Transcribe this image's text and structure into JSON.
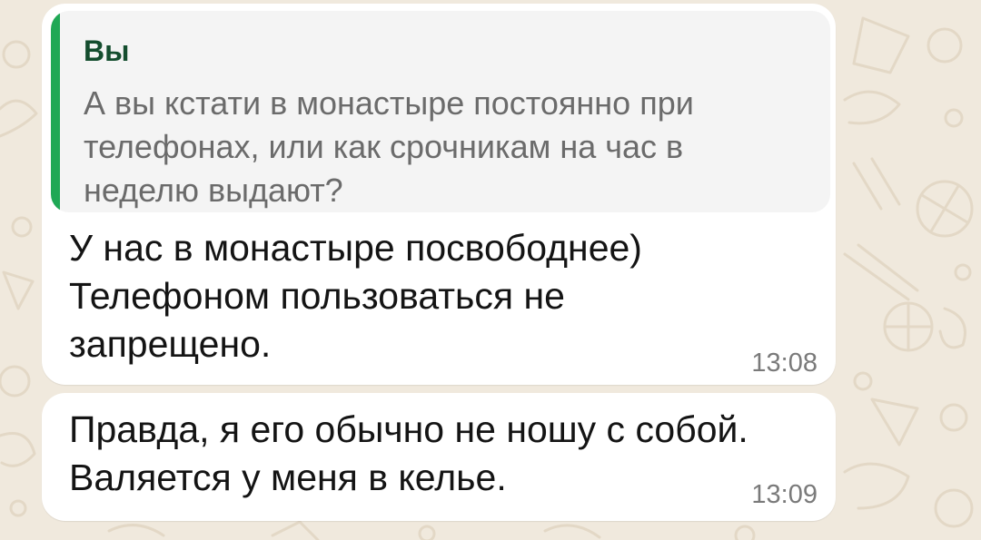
{
  "chat": {
    "messages": [
      {
        "reply_to": {
          "author": "Вы",
          "lines": [
            "А вы кстати в монастыре постоянно при",
            "телефонах, или как срочникам на час в",
            "неделю выдают?"
          ]
        },
        "lines": [
          "У нас в монастыре посвободнее)",
          "Телефоном пользоваться не",
          "запрещено."
        ],
        "time": "13:08"
      },
      {
        "lines": [
          "Правда, я его обычно не ношу с собой.",
          "Валяется у меня в келье."
        ],
        "time": "13:09"
      }
    ]
  },
  "colors": {
    "wallpaper": "#f0e9dd",
    "bubble": "#ffffff",
    "quote_background": "#f4f4f4",
    "quote_accent": "#1fa855",
    "quote_author": "#144d2e",
    "time_text": "#7a7a7a"
  }
}
